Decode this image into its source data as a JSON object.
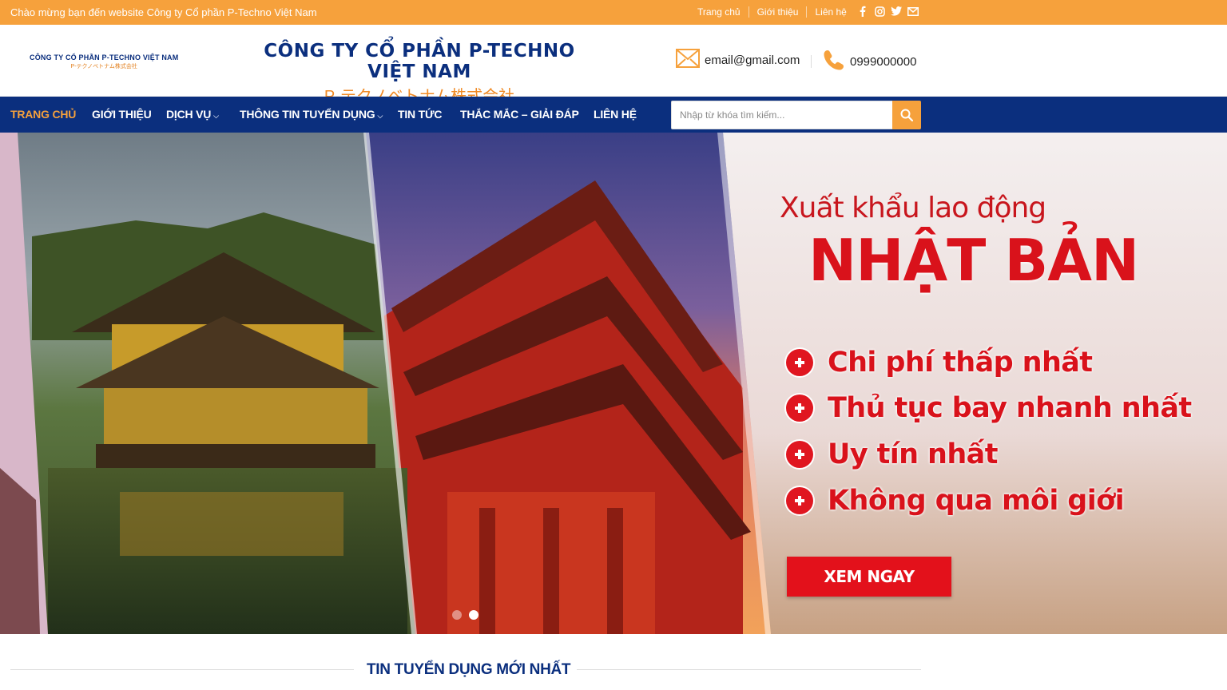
{
  "topbar": {
    "welcome": "Chào mừng bạn đến website Công ty Cổ phần P-Techno Việt Nam",
    "links": [
      "Trang chủ",
      "Giới thiệu",
      "Liên hệ"
    ],
    "social_icons": [
      "facebook-icon",
      "instagram-icon",
      "twitter-icon",
      "envelope-icon"
    ],
    "bg_color": "#f6a13c"
  },
  "header": {
    "logo_line1": "CÔNG TY CỔ PHẦN P-TECHNO VIỆT NAM",
    "logo_line2": "P-テクノベトナム株式会社",
    "brand_line1": "CÔNG TY CỔ PHẦN P-TECHNO VIỆT NAM",
    "brand_line2": "P-テクノベトナム株式会社",
    "email": "email@gmail.com",
    "phone": "0999000000"
  },
  "nav": {
    "items": [
      {
        "label": "TRANG CHỦ",
        "active": true
      },
      {
        "label": "GIỚI THIỆU"
      },
      {
        "label": "DỊCH VỤ",
        "dropdown": true
      },
      {
        "label": "THÔNG TIN TUYỂN DỤNG",
        "dropdown": true
      },
      {
        "label": "TIN TỨC"
      },
      {
        "label": "THẮC MẮC – GIẢI ĐÁP"
      },
      {
        "label": "LIÊN HỆ"
      }
    ],
    "search_placeholder": "Nhập từ khóa tìm kiếm...",
    "bg_color": "#0b2f7e",
    "accent": "#f6a13c"
  },
  "hero": {
    "subtitle": "Xuất khẩu lao động",
    "title": "NHẬT BẢN",
    "features": [
      "Chi phí thấp nhất",
      "Thủ tục bay nhanh nhất",
      "Uy tín nhất",
      "Không qua môi giới"
    ],
    "cta": "XEM NGAY",
    "slides": 2,
    "active_slide": 2,
    "accent": "#d9121b"
  },
  "section": {
    "title": "TIN TUYỂN DỤNG MỚI NHẤT"
  }
}
